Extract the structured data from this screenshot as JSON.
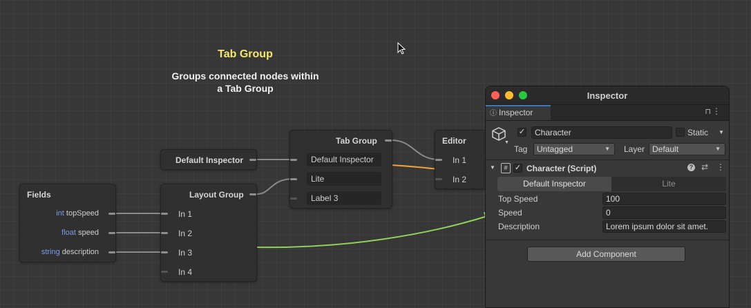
{
  "canvas": {
    "title": "Tab Group",
    "description_line1": "Groups connected nodes within",
    "description_line2": "a Tab Group",
    "title_color": "#f3e86b"
  },
  "nodes": {
    "fields": {
      "header": "Fields",
      "rows": [
        {
          "type": "int",
          "name": "topSpeed"
        },
        {
          "type": "float",
          "name": "speed"
        },
        {
          "type": "string",
          "name": "description"
        }
      ]
    },
    "default_inspector": {
      "header": "Default Inspector"
    },
    "layout_group": {
      "header": "Layout Group",
      "ports": [
        "In 1",
        "In 2",
        "In 3",
        "In 4"
      ]
    },
    "tab_group": {
      "header": "Tab Group",
      "ports": [
        "Default Inspector",
        "Lite",
        "Label 3"
      ]
    },
    "editor": {
      "header": "Editor",
      "ports": [
        "In 1",
        "In 2"
      ]
    }
  },
  "wire_colors": {
    "default": "#8a8a8a",
    "orange": "#f0a33a",
    "green": "#8fd25a"
  },
  "inspector": {
    "window_title": "Inspector",
    "tab_label": "Inspector",
    "object_name": "Character",
    "object_active": true,
    "static_label": "Static",
    "static_checked": false,
    "tag_label": "Tag",
    "tag_value": "Untagged",
    "layer_label": "Layer",
    "layer_value": "Default",
    "component_title": "Character (Script)",
    "component_enabled": true,
    "toggle_options": [
      "Default Inspector",
      "Lite"
    ],
    "toggle_selected": "Default Inspector",
    "fields": [
      {
        "label": "Top Speed",
        "value": "100"
      },
      {
        "label": "Speed",
        "value": "0"
      },
      {
        "label": "Description",
        "value": "Lorem ipsum dolor sit amet."
      }
    ],
    "add_component_label": "Add Component",
    "traffic_colors": [
      "#fe5f57",
      "#febc2e",
      "#28c840"
    ]
  }
}
